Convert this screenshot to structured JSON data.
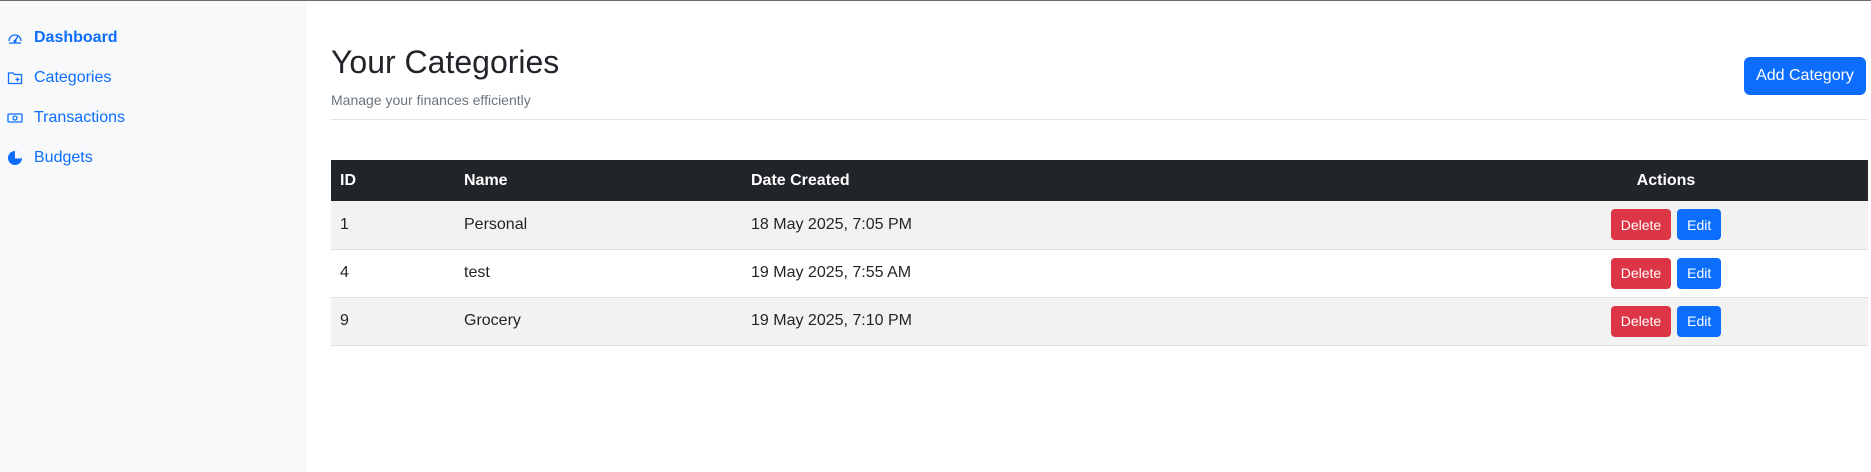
{
  "sidebar": {
    "items": [
      {
        "label": "Dashboard",
        "icon": "speedometer-icon",
        "active": true
      },
      {
        "label": "Categories",
        "icon": "folder-plus-icon",
        "active": false
      },
      {
        "label": "Transactions",
        "icon": "cash-icon",
        "active": false
      },
      {
        "label": "Budgets",
        "icon": "pie-chart-icon",
        "active": false
      }
    ]
  },
  "header": {
    "title": "Your Categories",
    "subtitle": "Manage your finances efficiently",
    "add_label": "Add Category"
  },
  "table": {
    "columns": [
      "ID",
      "Name",
      "Date Created",
      "Actions"
    ],
    "rows": [
      {
        "id": "1",
        "name": "Personal",
        "date": "18 May 2025, 7:05 PM"
      },
      {
        "id": "4",
        "name": "test",
        "date": "19 May 2025, 7:55 AM"
      },
      {
        "id": "9",
        "name": "Grocery",
        "date": "19 May 2025, 7:10 PM"
      }
    ],
    "delete_label": "Delete",
    "edit_label": "Edit"
  },
  "colors": {
    "primary": "#0d6efd",
    "danger": "#dc3545",
    "table_header": "#212529",
    "sidebar_bg": "#f8f9fa"
  }
}
